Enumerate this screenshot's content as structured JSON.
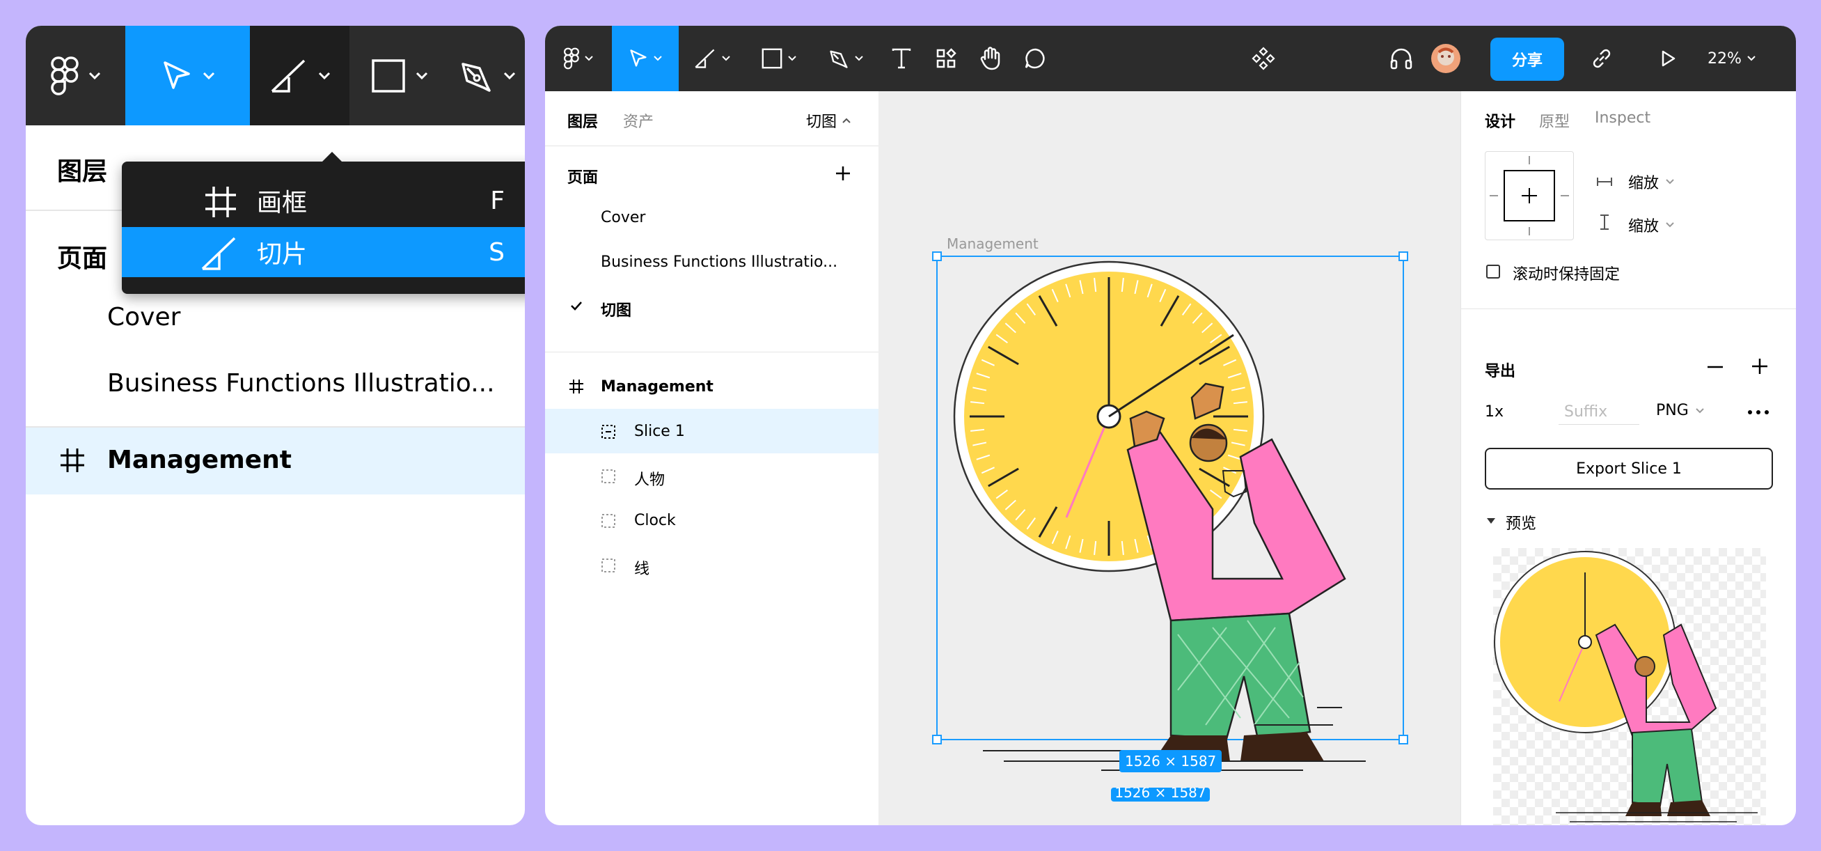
{
  "left_panel": {
    "tabs_partial": "图层",
    "pages_partial": "页面",
    "pages": [
      "Cover",
      "Business Functions Illustratio..."
    ],
    "frame_name": "Management"
  },
  "dropdown": {
    "items": [
      {
        "label": "画框",
        "shortcut": "F",
        "icon": "frame-icon"
      },
      {
        "label": "切片",
        "shortcut": "S",
        "icon": "slice-icon"
      }
    ]
  },
  "toolbar": {
    "share_label": "分享",
    "zoom_label": "22%"
  },
  "layers_panel": {
    "tabs": [
      "图层",
      "资产"
    ],
    "page_selector": "切图",
    "pages_header": "页面",
    "pages": [
      "Cover",
      "Business Functions Illustratio...",
      "切图"
    ],
    "current_page": "切图",
    "frame": "Management",
    "children": [
      "Slice 1",
      "人物",
      "Clock",
      "线"
    ]
  },
  "canvas": {
    "frame_label": "Management",
    "size_badge": "1526 × 1587",
    "ghost_badge": "1526 × 1587"
  },
  "design_panel": {
    "tabs": [
      "设计",
      "原型",
      "Inspect"
    ],
    "constraint_h": "缩放",
    "constraint_v": "缩放",
    "fix_scroll": "滚动时保持固定",
    "export_title": "导出",
    "export_scale": "1x",
    "export_suffix_placeholder": "Suffix",
    "export_format": "PNG",
    "export_button": "Export Slice 1",
    "preview_label": "预览"
  },
  "colors": {
    "accent": "#0d99ff",
    "toolbar": "#2c2c2c",
    "background": "#c4b5fd",
    "selected_row": "#e5f4ff",
    "clock_face": "#ffd84d",
    "shirt": "#ff7ac0",
    "pants": "#4cbb7a"
  }
}
